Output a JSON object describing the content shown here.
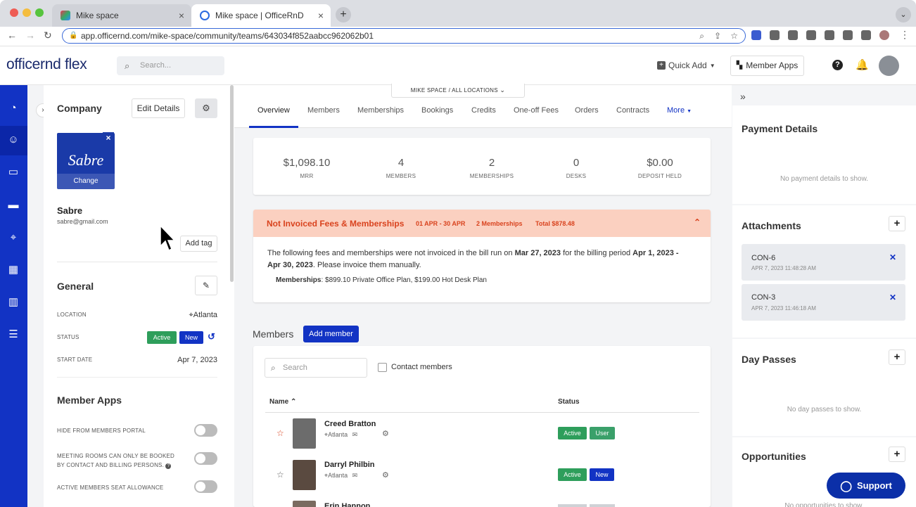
{
  "browser": {
    "tabs": [
      {
        "title": "Mike space"
      },
      {
        "title": "Mike space | OfficeRnD"
      }
    ],
    "new_tab": "+",
    "url": "app.officernd.com/mike-space/community/teams/643034f852aabcc962062b01"
  },
  "header": {
    "logo": "officernd flex",
    "search_placeholder": "Search...",
    "quick_add": "Quick Add",
    "member_apps": "Member Apps"
  },
  "location_selector": "MIKE SPACE  /  ALL LOCATIONS",
  "company": {
    "section_title": "Company",
    "edit_details": "Edit Details",
    "logo_text": "Sabre",
    "change": "Change",
    "name": "Sabre",
    "email": "sabre@gmail.com",
    "add_tag": "Add tag"
  },
  "general": {
    "title": "General",
    "location_label": "LOCATION",
    "location_value": "Atlanta",
    "status_label": "STATUS",
    "status_active": "Active",
    "status_new": "New",
    "start_label": "START DATE",
    "start_value": "Apr 7, 2023"
  },
  "member_apps": {
    "title": "Member Apps",
    "items": [
      {
        "label": "HIDE FROM MEMBERS PORTAL"
      },
      {
        "label": "MEETING ROOMS CAN ONLY BE BOOKED BY CONTACT AND BILLING PERSONS."
      },
      {
        "label": "ACTIVE MEMBERS SEAT ALLOWANCE"
      }
    ]
  },
  "tabs": [
    "Overview",
    "Members",
    "Memberships",
    "Bookings",
    "Credits",
    "One-off Fees",
    "Orders",
    "Contracts",
    "More"
  ],
  "stats": [
    {
      "value": "$1,098.10",
      "label": "MRR"
    },
    {
      "value": "4",
      "label": "MEMBERS"
    },
    {
      "value": "2",
      "label": "MEMBERSHIPS"
    },
    {
      "value": "0",
      "label": "DESKS"
    },
    {
      "value": "$0.00",
      "label": "DEPOSIT HELD"
    }
  ],
  "notice": {
    "title": "Not Invoiced Fees & Memberships",
    "period": "01 APR - 30 APR",
    "count": "2 Memberships",
    "total": "Total $878.48",
    "text_a": "The following fees and memberships were not invoiced in the bill run on",
    "date_a": "Mar 27, 2023",
    "text_b": "for the billing period",
    "date_b": "Apr 1, 2023 - Apr",
    "date_c": "30, 2023",
    "text_c": ". Please invoice them manually.",
    "memberships_label": "Memberships",
    "memberships_value": ": $899.10 Private Office Plan, $199.00 Hot Desk Plan"
  },
  "members": {
    "title": "Members",
    "add_member": "Add member",
    "search_placeholder": "Search",
    "contact_members": "Contact members",
    "col_name": "Name",
    "col_status": "Status",
    "rows": [
      {
        "name": "Creed Bratton",
        "location": "Atlanta",
        "status": "Active",
        "tag": "User"
      },
      {
        "name": "Darryl Philbin",
        "location": "Atlanta",
        "status": "Active",
        "tag": "New"
      },
      {
        "name": "Erin Hannon",
        "location": "",
        "status": "",
        "tag": ""
      }
    ]
  },
  "right": {
    "payment_title": "Payment Details",
    "payment_empty": "No payment details to show.",
    "attachments_title": "Attachments",
    "attachments": [
      {
        "name": "CON-6",
        "date": "APR 7, 2023 11:48:28 AM"
      },
      {
        "name": "CON-3",
        "date": "APR 7, 2023 11:46:18 AM"
      }
    ],
    "daypasses_title": "Day Passes",
    "daypasses_empty": "No day passes to show.",
    "opportunities_title": "Opportunities",
    "opportunities_empty": "No opportunities to show."
  },
  "support": "Support",
  "colors": {
    "primary": "#1233c4",
    "success": "#2e9e5b",
    "notice_bg": "#fbd0c0",
    "notice_text": "#d9431e"
  }
}
